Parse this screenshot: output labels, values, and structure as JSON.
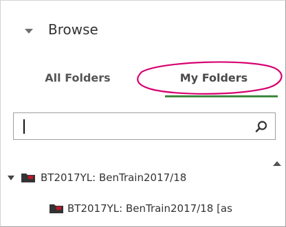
{
  "browse": {
    "title": "Browse"
  },
  "tabs": [
    {
      "label": "All Folders",
      "active": false
    },
    {
      "label": "My Folders",
      "active": true
    }
  ],
  "search": {
    "value": "",
    "placeholder": ""
  },
  "tree": {
    "items": [
      {
        "label": "BT2017YL: BenTrain2017/18",
        "expanded": true,
        "level": 0
      },
      {
        "label": "BT2017YL: BenTrain2017/18 [as",
        "level": 1
      }
    ]
  },
  "colors": {
    "active_tab_underline": "#3d8a3d",
    "highlight_annotation": "#d6006f",
    "folder_icon": "#333333",
    "folder_badge": "#c0152a"
  }
}
